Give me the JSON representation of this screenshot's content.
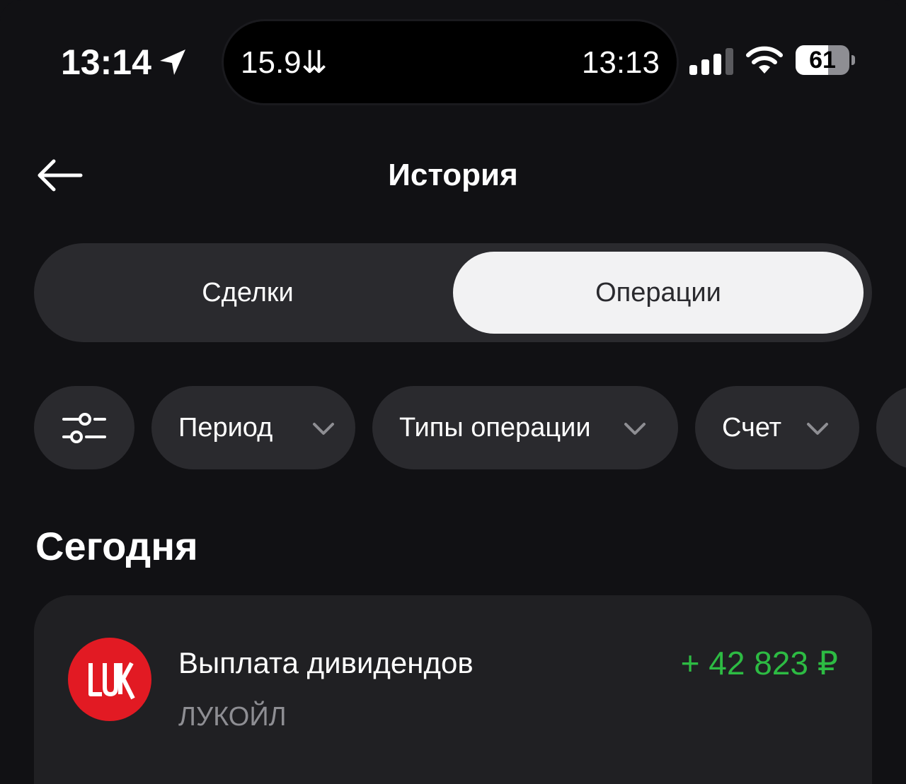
{
  "status_bar": {
    "time": "13:14",
    "island_left": "15.9⇊",
    "island_right": "13:13",
    "battery_level": 61,
    "battery_text": "61"
  },
  "header": {
    "title": "История"
  },
  "tabs": {
    "deals_label": "Сделки",
    "operations_label": "Операции",
    "selected": "operations"
  },
  "filters": {
    "period_label": "Период",
    "types_label": "Типы операции",
    "account_label": "Счет"
  },
  "section": {
    "title": "Сегодня"
  },
  "operations": [
    {
      "title": "Выплата дивидендов",
      "subtitle": "ЛУКОЙЛ",
      "amount": "+ 42 823 ₽",
      "logo_text": "LUK"
    }
  ],
  "colors": {
    "background": "#111114",
    "surface": "#2a2a2e",
    "card": "#202023",
    "positive_amount": "#2dbb43",
    "logo_red": "#e21a23",
    "muted_text": "#8e8e93"
  }
}
